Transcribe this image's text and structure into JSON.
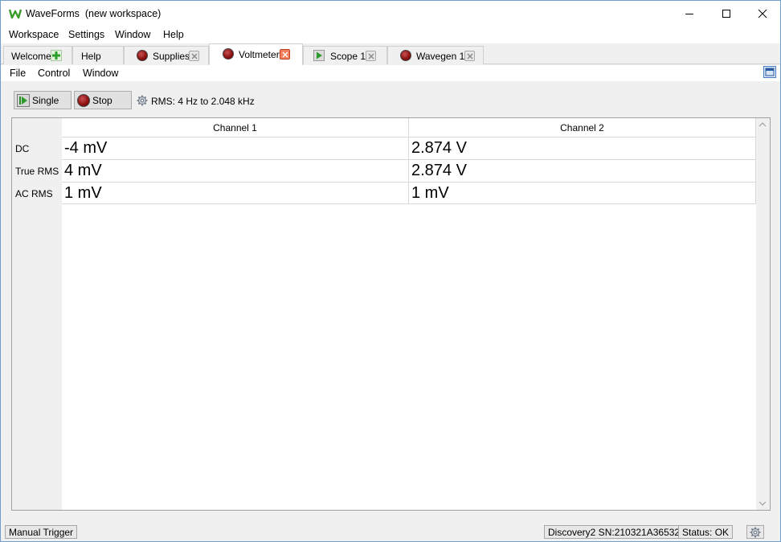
{
  "window": {
    "app_name": "WaveForms",
    "workspace": "(new workspace)"
  },
  "menubar": [
    "Workspace",
    "Settings",
    "Window",
    "Help"
  ],
  "tabs": [
    {
      "label": "Welcome",
      "icon": "add-icon"
    },
    {
      "label": "Help",
      "icon": ""
    },
    {
      "label": "Supplies",
      "icon": "stopped-icon",
      "closable": true
    },
    {
      "label": "Voltmeter",
      "icon": "stopped-icon",
      "closable": true,
      "active": true
    },
    {
      "label": "Scope 1",
      "icon": "run-icon",
      "closable": true
    },
    {
      "label": "Wavegen 1",
      "icon": "stopped-icon",
      "closable": true
    }
  ],
  "submenu": [
    "File",
    "Control",
    "Window"
  ],
  "toolbar": {
    "single_label": "Single",
    "stop_label": "Stop",
    "rms_label": "RMS: 4 Hz to 2.048 kHz"
  },
  "table": {
    "columns": [
      "Channel 1",
      "Channel 2"
    ],
    "rows": [
      {
        "label": "DC",
        "values": [
          "-4 mV",
          "2.874 V"
        ]
      },
      {
        "label": "True RMS",
        "values": [
          "4 mV",
          "2.874 V"
        ]
      },
      {
        "label": "AC RMS",
        "values": [
          "1 mV",
          "1 mV"
        ]
      }
    ]
  },
  "statusbar": {
    "trigger": "Manual Trigger",
    "device": "Discovery2 SN:210321A36532",
    "status": "Status: OK"
  },
  "colors": {
    "accent": "#6f9fcf",
    "stop_red": "#8a1010",
    "run_green": "#2a9a2a",
    "close_active": "#f08060"
  }
}
